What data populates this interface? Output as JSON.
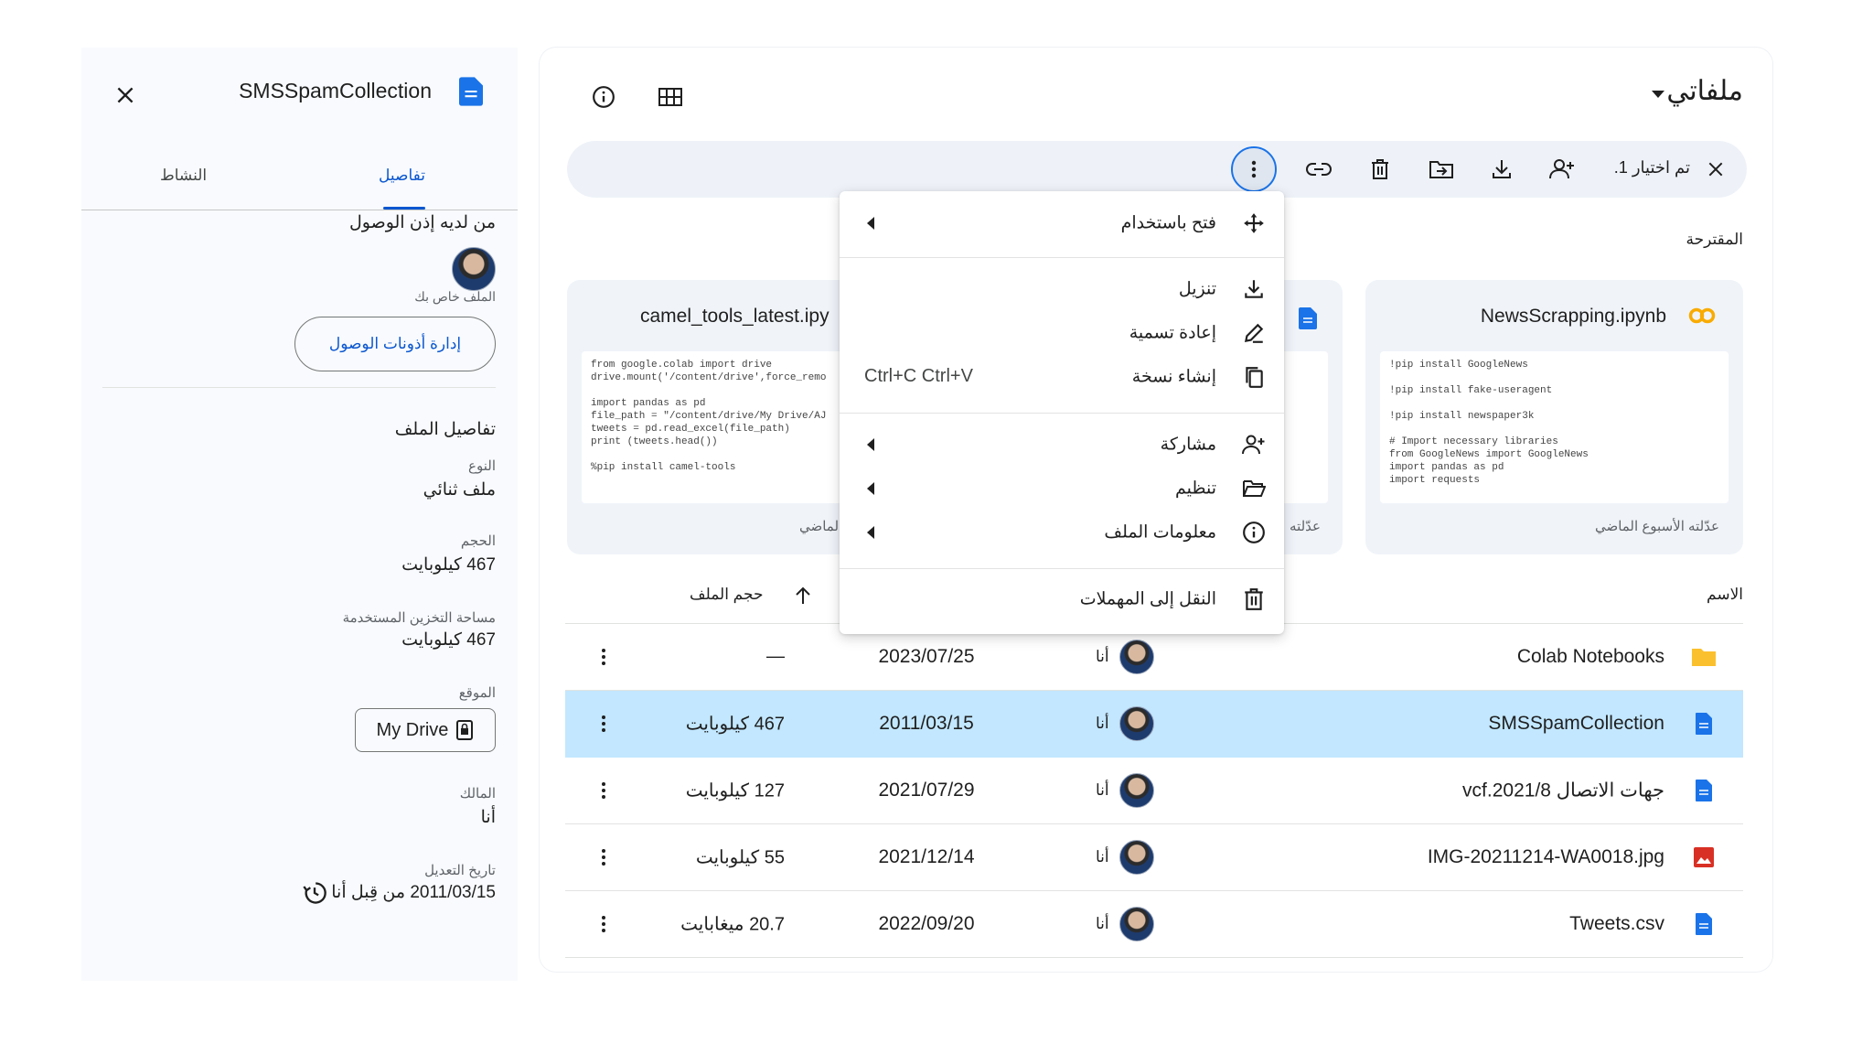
{
  "details": {
    "file_title": "SMSSpamCollection",
    "tabs": [
      {
        "label": "تفاصيل",
        "active": true
      },
      {
        "label": "النشاط",
        "active": false
      }
    ],
    "access_heading": "من لديه إذن الوصول",
    "private_note": "الملف خاص بك",
    "manage_access_button": "إدارة أذونات الوصول",
    "file_details_heading": "تفاصيل الملف",
    "fields": [
      {
        "label": "النوع",
        "value": "ملف ثنائي"
      },
      {
        "label": "الحجم",
        "value": "467 كيلوبايت"
      },
      {
        "label": "مساحة التخزين المستخدمة",
        "value": "467 كيلوبايت"
      },
      {
        "label": "الموقع",
        "value": "My Drive"
      },
      {
        "label": "المالك",
        "value": "أنا"
      },
      {
        "label": "تاريخ التعديل",
        "value": "2011/03/15 من قِبل أنا"
      }
    ]
  },
  "header": {
    "title": "ملفاتي"
  },
  "selection_bar": {
    "count_label": "تم اختيار 1."
  },
  "context_menu": {
    "items": [
      {
        "label": "فتح باستخدام",
        "icon": "open-with-icon",
        "submenu": true
      },
      {
        "label": "تنزيل",
        "icon": "download-icon",
        "submenu": false
      },
      {
        "label": "إعادة تسمية",
        "icon": "rename-icon",
        "submenu": false
      },
      {
        "label": "إنشاء نسخة",
        "icon": "copy-icon",
        "shortcut": "Ctrl+C Ctrl+V",
        "submenu": false
      },
      {
        "label": "مشاركة",
        "icon": "share-icon",
        "submenu": true
      },
      {
        "label": "تنظيم",
        "icon": "organize-icon",
        "submenu": true
      },
      {
        "label": "معلومات الملف",
        "icon": "info-icon",
        "submenu": true
      },
      {
        "label": "النقل إلى المهملات",
        "icon": "trash-icon",
        "submenu": false
      }
    ]
  },
  "suggested": {
    "heading": "المقترحة",
    "cards": [
      {
        "title": "NewsScrapping.ipynb",
        "icon": "colab-icon",
        "code": [
          "!pip install GoogleNews",
          "",
          "!pip install fake-useragent",
          "",
          "!pip install newspaper3k",
          "",
          "# Import necessary libraries",
          "from GoogleNews import GoogleNews",
          "import pandas as pd",
          "import requests"
        ],
        "footer": "عدّلته الأسبوع الماضي"
      },
      {
        "title": "",
        "icon": "doc-icon",
        "code": [],
        "footer": "عدّلته"
      },
      {
        "title": "camel_tools_latest.ipy",
        "icon": "",
        "code": [
          "from google.colab import drive",
          "drive.mount('/content/drive',force_remo",
          "",
          "import pandas as pd",
          "file_path = \"/content/drive/My Drive/AJ",
          "tweets = pd.read_excel(file_path)",
          "print (tweets.head())",
          "",
          "%pip install camel-tools"
        ],
        "footer": "الماضي"
      }
    ]
  },
  "table": {
    "headers": {
      "name": "الاسم",
      "size": "حجم الملف"
    },
    "rows": [
      {
        "name": "Colab Notebooks",
        "icon": "folder-icon",
        "icon_color": "#fbc02d",
        "owner": "أنا",
        "date": "2023/07/25",
        "size": "—",
        "selected": false
      },
      {
        "name": "SMSSpamCollection",
        "icon": "doc-icon",
        "icon_color": "#1a73e8",
        "owner": "أنا",
        "date": "2011/03/15",
        "size": "467 كيلوبايت",
        "selected": true
      },
      {
        "name": "جهات الاتصال 2021/8.vcf",
        "icon": "doc-icon",
        "icon_color": "#1a73e8",
        "owner": "أنا",
        "date": "2021/07/29",
        "size": "127 كيلوبايت",
        "selected": false
      },
      {
        "name": "IMG-20211214-WA0018.jpg",
        "icon": "image-icon",
        "icon_color": "#d93025",
        "owner": "أنا",
        "date": "2021/12/14",
        "size": "55 كيلوبايت",
        "selected": false
      },
      {
        "name": "Tweets.csv",
        "icon": "doc-icon",
        "icon_color": "#1a73e8",
        "owner": "أنا",
        "date": "2022/09/20",
        "size": "20.7 ميغابايت",
        "selected": false
      }
    ]
  },
  "colors": {
    "accent": "#0b57d0",
    "selected_row": "#c2e7ff",
    "panel_bg": "#f8fafd"
  }
}
